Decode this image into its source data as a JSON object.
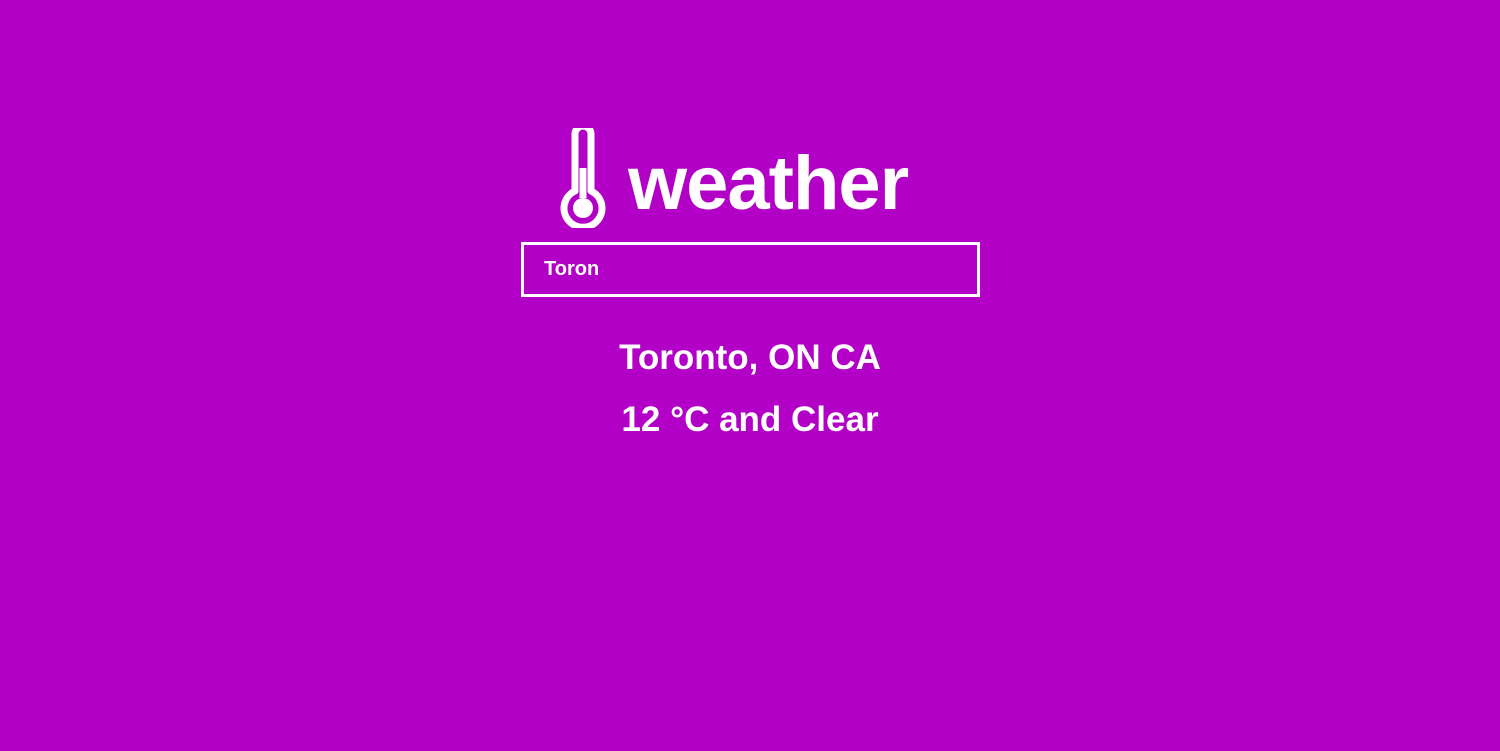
{
  "app": {
    "title": "weather",
    "icon": "thermometer-icon",
    "background_color": "#b300c6",
    "text_color": "#ffffff"
  },
  "search": {
    "value": "Toron"
  },
  "result": {
    "location": "Toronto, ON CA",
    "conditions": "12 °C and Clear"
  }
}
